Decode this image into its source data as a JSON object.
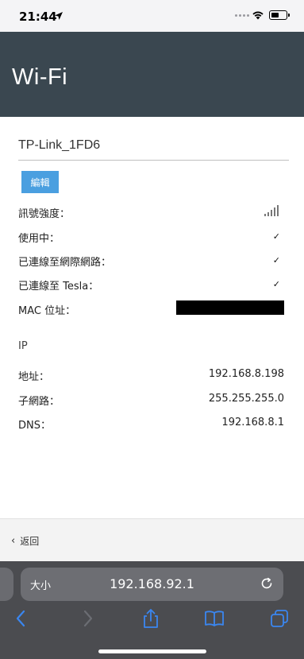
{
  "status_bar": {
    "time": "21:44"
  },
  "header": {
    "title": "Wi-Fi"
  },
  "network": {
    "name": "TP-Link_1FD6",
    "edit_label": "編輯"
  },
  "details": {
    "signal_label": "訊號強度：",
    "signal_level": 5,
    "in_use_label": "使用中：",
    "internet_label": "已連線至網際網路：",
    "tesla_label": "已連線至 Tesla：",
    "mac_label": "MAC 位址：",
    "check_mark": "✓"
  },
  "ip": {
    "heading": "IP",
    "address_label": "地址：",
    "address_value": "192.168.8.198",
    "subnet_label": "子網路：",
    "subnet_value": "255.255.255.0",
    "dns_label": "DNS：",
    "dns_value": "192.168.8.1"
  },
  "back": {
    "label": "返回"
  },
  "safari": {
    "text_size_label": "大小",
    "url": "192.168.92.1",
    "icons": [
      "back-icon",
      "forward-icon",
      "share-icon",
      "bookmarks-icon",
      "tabs-icon",
      "reload-icon"
    ]
  },
  "colors": {
    "header_bg": "#3a4750",
    "accent": "#4a9fe0",
    "toolbar_bg": "#4b4c50",
    "toolbar_icon": "#3a86f0"
  }
}
